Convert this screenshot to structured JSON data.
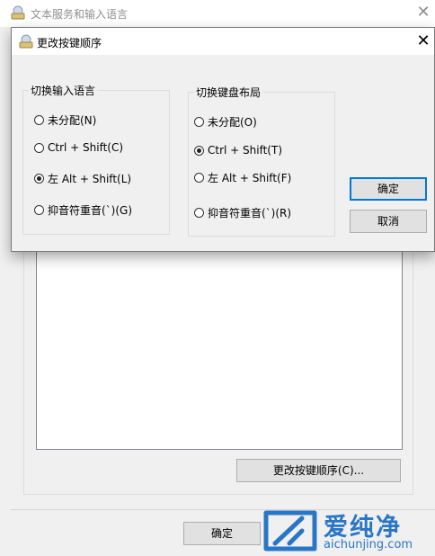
{
  "parent": {
    "title": "文本服务和输入语言",
    "close_glyph": "✕",
    "change_sequence_button": "更改按键顺序(C)...",
    "ok_button": "确定"
  },
  "dialog": {
    "title": "更改按键顺序",
    "close_glyph": "✕",
    "left_group": {
      "legend": "切换输入语言",
      "options": [
        {
          "label": "未分配(N)",
          "checked": false
        },
        {
          "label": "Ctrl + Shift(C)",
          "checked": false
        },
        {
          "label": "左 Alt + Shift(L)",
          "checked": true
        },
        {
          "label": "抑音符重音(`)(G)",
          "checked": false
        }
      ]
    },
    "right_group": {
      "legend": "切换键盘布局",
      "options": [
        {
          "label": "未分配(O)",
          "checked": false
        },
        {
          "label": "Ctrl + Shift(T)",
          "checked": true
        },
        {
          "label": "左 Alt + Shift(F)",
          "checked": false
        },
        {
          "label": "抑音符重音(`)(R)",
          "checked": false
        }
      ]
    },
    "ok_button": "确定",
    "cancel_button": "取消"
  },
  "watermark": {
    "title": "爱纯净",
    "url": "aichunjing.com"
  },
  "colors": {
    "accent": "#0078d7",
    "watermark": "#2a76c6"
  }
}
